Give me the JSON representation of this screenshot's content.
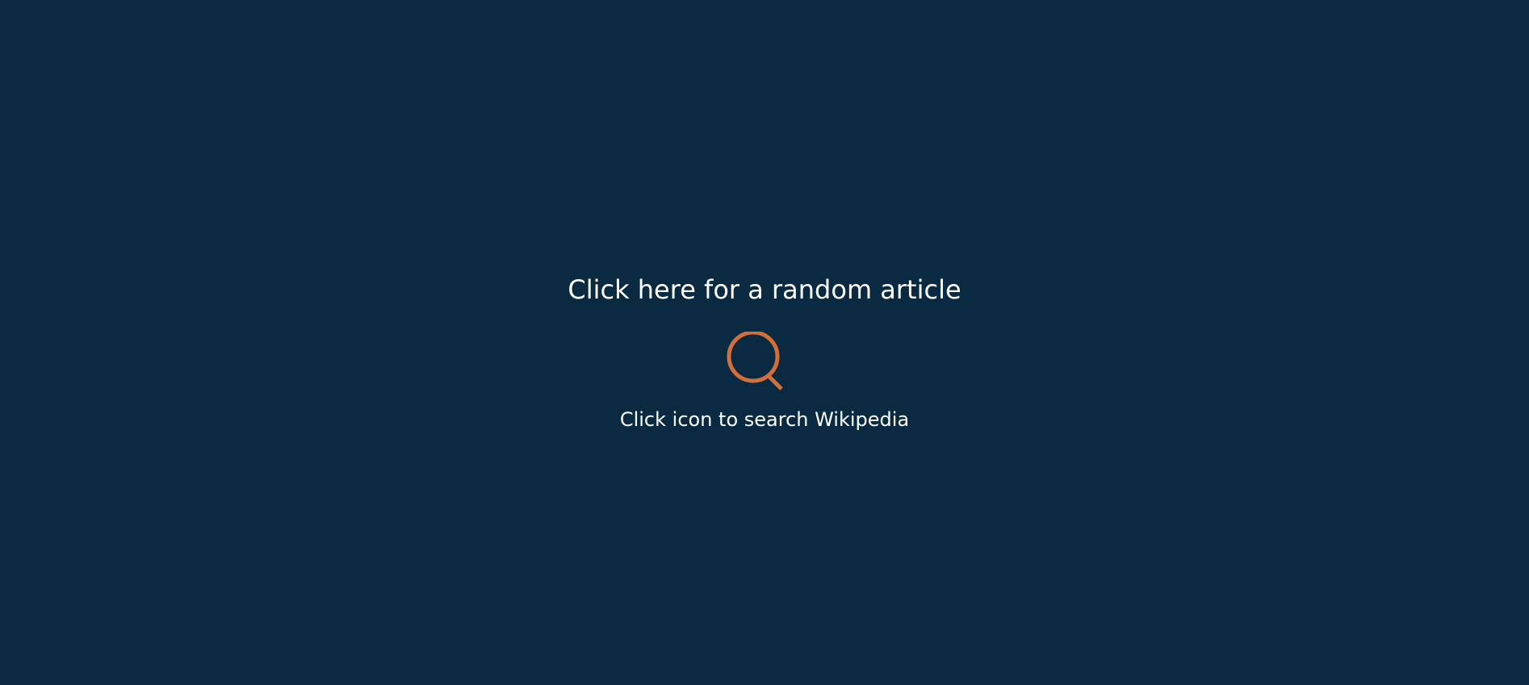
{
  "random_article": {
    "label": "Click here for a random article"
  },
  "search": {
    "icon": "search-icon",
    "hint": "Click icon to search Wikipedia"
  },
  "colors": {
    "background": "#092a40",
    "text": "#ffffff",
    "accent": "#d46f3c"
  }
}
